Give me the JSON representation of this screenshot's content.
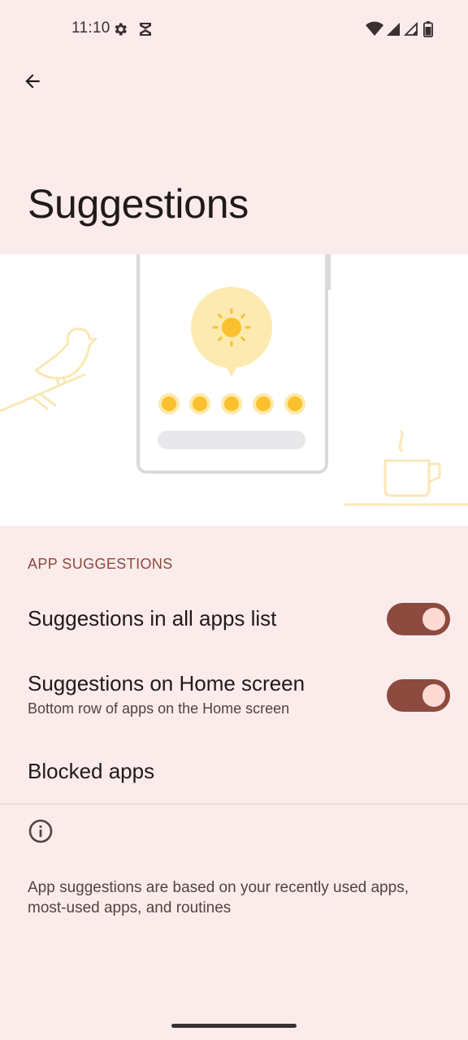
{
  "status_bar": {
    "time": "11:10",
    "icons": [
      "settings-gear-icon",
      "shield-icon",
      "wifi-icon",
      "signal-icon",
      "signal-icon",
      "battery-icon"
    ]
  },
  "app_bar": {
    "back_icon": "arrow-back-icon",
    "title": "Suggestions"
  },
  "illustration": {
    "description_icons": [
      "phone",
      "sun-bubble",
      "bird-on-branch",
      "coffee-cup"
    ],
    "accent_color": "#fbc02d",
    "bubble_color": "#fef0b8"
  },
  "section": {
    "header": "APP SUGGESTIONS",
    "items": [
      {
        "title": "Suggestions in all apps list",
        "toggle": true
      },
      {
        "title": "Suggestions on Home screen",
        "subtitle": "Bottom row of apps on the Home screen",
        "toggle": true
      },
      {
        "title": "Blocked apps"
      }
    ]
  },
  "footer": {
    "info_icon": "info-icon",
    "text": "App suggestions are based on your recently used apps, most-used apps, and routines"
  },
  "colors": {
    "background": "#fbeceb",
    "accent": "#8d4a3f",
    "thumb": "#ffdad4"
  }
}
